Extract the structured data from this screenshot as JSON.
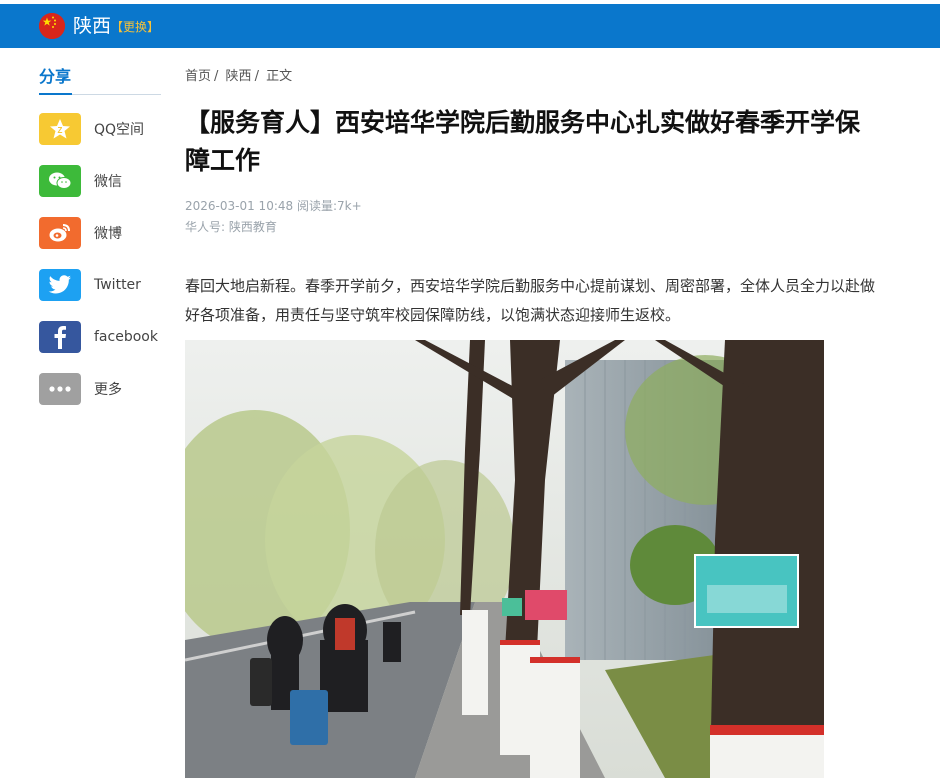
{
  "header": {
    "region": "陕西",
    "switch_label": "【更换】",
    "brand_red": "#d8261b",
    "brand_blue": "#0a77cc",
    "flag_icon": "china-flag-icon"
  },
  "sidebar": {
    "title": "分享",
    "items": [
      {
        "label": "QQ空间",
        "icon": "qzone-icon",
        "color": "#f7c933"
      },
      {
        "label": "微信",
        "icon": "wechat-icon",
        "color": "#3dba3a"
      },
      {
        "label": "微博",
        "icon": "weibo-icon",
        "color": "#f26b2e"
      },
      {
        "label": "Twitter",
        "icon": "twitter-icon",
        "color": "#1da1f2"
      },
      {
        "label": "facebook",
        "icon": "facebook-icon",
        "color": "#36579e"
      },
      {
        "label": "更多",
        "icon": "more-icon",
        "color": "#a0a0a0"
      }
    ]
  },
  "breadcrumb": {
    "home": "首页",
    "region": "陕西",
    "current": "正文"
  },
  "article": {
    "title": "【服务育人】西安培华学院后勤服务中心扎实做好春季开学保障工作",
    "datetime": "2026-03-01 10:48",
    "reads": "阅读量:7k+",
    "author": "华人号: 陕西教育",
    "lead": "春回大地启新程。春季开学前夕，西安培华学院后勤服务中心提前谋划、周密部署，全体人员全力以赴做好各项准备，用责任与坚守筑牢校园保障防线，以饱满状态迎接师生返校。"
  }
}
